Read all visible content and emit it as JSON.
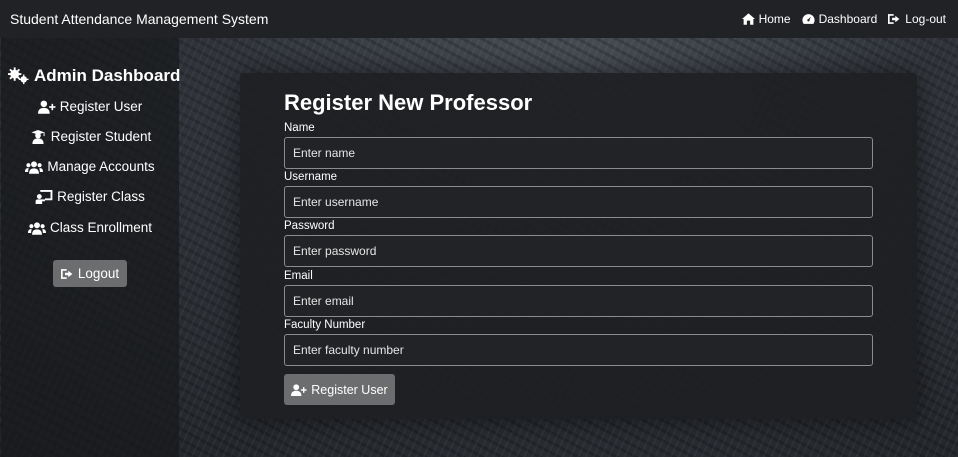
{
  "navbar": {
    "brand": "Student Attendance Management System",
    "links": [
      {
        "label": "Home",
        "icon": "home-icon"
      },
      {
        "label": "Dashboard",
        "icon": "gauge-icon"
      },
      {
        "label": "Log-out",
        "icon": "sign-out-icon"
      }
    ]
  },
  "sidebar": {
    "title": "Admin Dashboard",
    "items": [
      {
        "label": "Register User",
        "icon": "user-plus-icon"
      },
      {
        "label": "Register Student",
        "icon": "graduate-icon"
      },
      {
        "label": "Manage Accounts",
        "icon": "users-icon"
      },
      {
        "label": "Register Class",
        "icon": "chalkboard-teacher-icon"
      },
      {
        "label": "Class Enrollment",
        "icon": "user-group-icon"
      }
    ],
    "logout_label": "Logout"
  },
  "form": {
    "title": "Register New Professor",
    "fields": [
      {
        "label": "Name",
        "placeholder": "Enter name"
      },
      {
        "label": "Username",
        "placeholder": "Enter username"
      },
      {
        "label": "Password",
        "placeholder": "Enter password"
      },
      {
        "label": "Email",
        "placeholder": "Enter email"
      },
      {
        "label": "Faculty Number",
        "placeholder": "Enter faculty number"
      }
    ],
    "submit_label": "Register User"
  },
  "colors": {
    "navbar_bg": "#212226",
    "panel_bg": "#1e1f22",
    "button_bg": "#6c6d6f"
  }
}
